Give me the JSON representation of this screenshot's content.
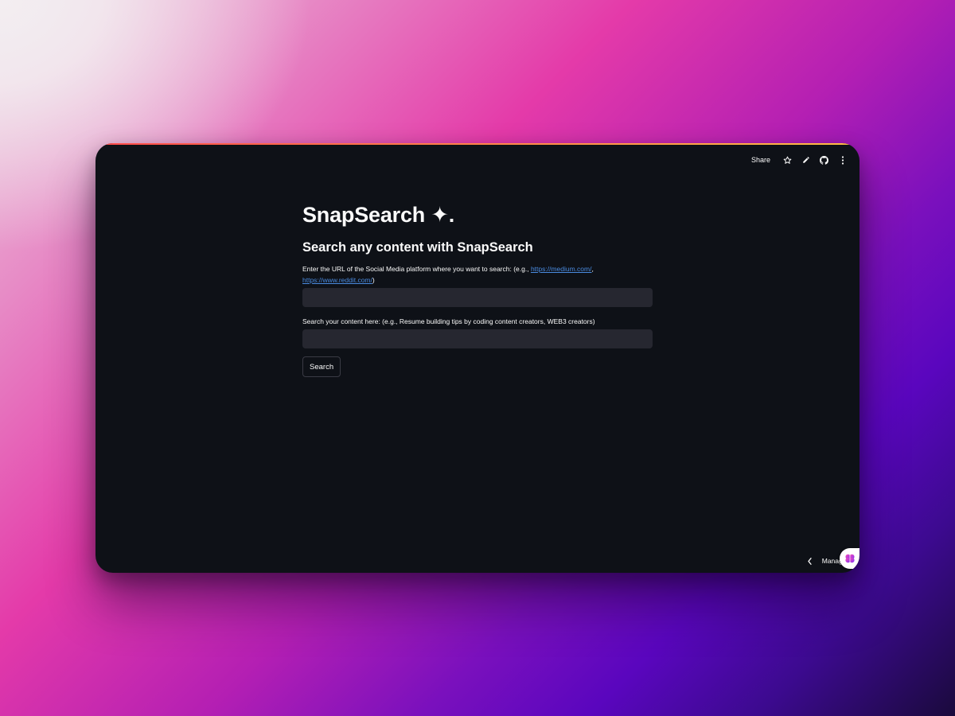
{
  "toolbar": {
    "share_label": "Share",
    "icons": [
      "star-icon",
      "pencil-icon",
      "github-icon",
      "more-vertical-icon"
    ]
  },
  "app": {
    "title": "SnapSearch ✦.",
    "subtitle": "Search any content with SnapSearch"
  },
  "url_field": {
    "label_prefix": "Enter the URL of the Social Media platform where you want to search: (e.g., ",
    "link1": "https://medium.com/",
    "separator": ", ",
    "link2": "https://www.reddit.com/",
    "label_suffix": ")",
    "value": "",
    "placeholder": ""
  },
  "query_field": {
    "label": "Search your content here: (e.g., Resume building tips by coding content creators, WEB3 creators)",
    "value": "",
    "placeholder": ""
  },
  "search_button": {
    "label": "Search"
  },
  "manage": {
    "label": "Manage app",
    "icons": [
      "chevron-left-icon",
      "streamlit-logo-icon"
    ]
  },
  "colors": {
    "window_bg": "#0e1117",
    "input_bg": "#262730",
    "text": "#fafafa",
    "link": "#4a8be0",
    "accent_start": "#ff4b4b",
    "accent_end": "#ffbd45"
  }
}
